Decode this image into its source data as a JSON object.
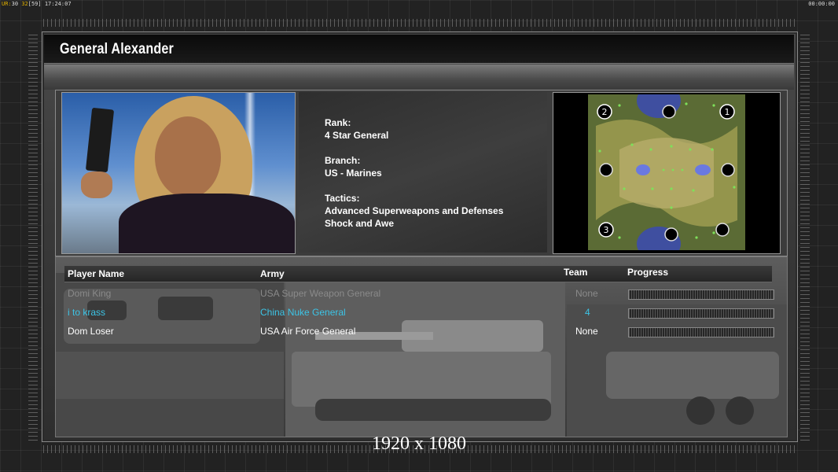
{
  "hud": {
    "left_prefix": "UR:",
    "left_values": "30",
    "left_rest": "32",
    "left_bracket": "[59]",
    "left_time": "17:24:07",
    "right_time": "00:00:00"
  },
  "general": {
    "title": "General Alexander",
    "rank_label": "Rank:",
    "rank_value": "4 Star General",
    "branch_label": "Branch:",
    "branch_value": "US - Marines",
    "tactics_label": "Tactics:",
    "tactics_line1": "Advanced Superweapons and Defenses",
    "tactics_line2": "Shock and Awe"
  },
  "map": {
    "markers": [
      "2",
      "1",
      "3"
    ]
  },
  "table": {
    "headers": {
      "player": "Player Name",
      "army": "Army",
      "team": "Team",
      "progress": "Progress"
    },
    "rows": [
      {
        "player": "Domi King",
        "army": "USA Super Weapon General",
        "team": "None",
        "color": "#8a8a8a"
      },
      {
        "player": "i to krass",
        "army": "China Nuke General",
        "team": "4",
        "color": "#3cc4e6"
      },
      {
        "player": "Dom Loser",
        "army": "USA Air Force General",
        "team": "None",
        "color": "#ffffff"
      }
    ]
  },
  "caption": "1920 x 1080"
}
